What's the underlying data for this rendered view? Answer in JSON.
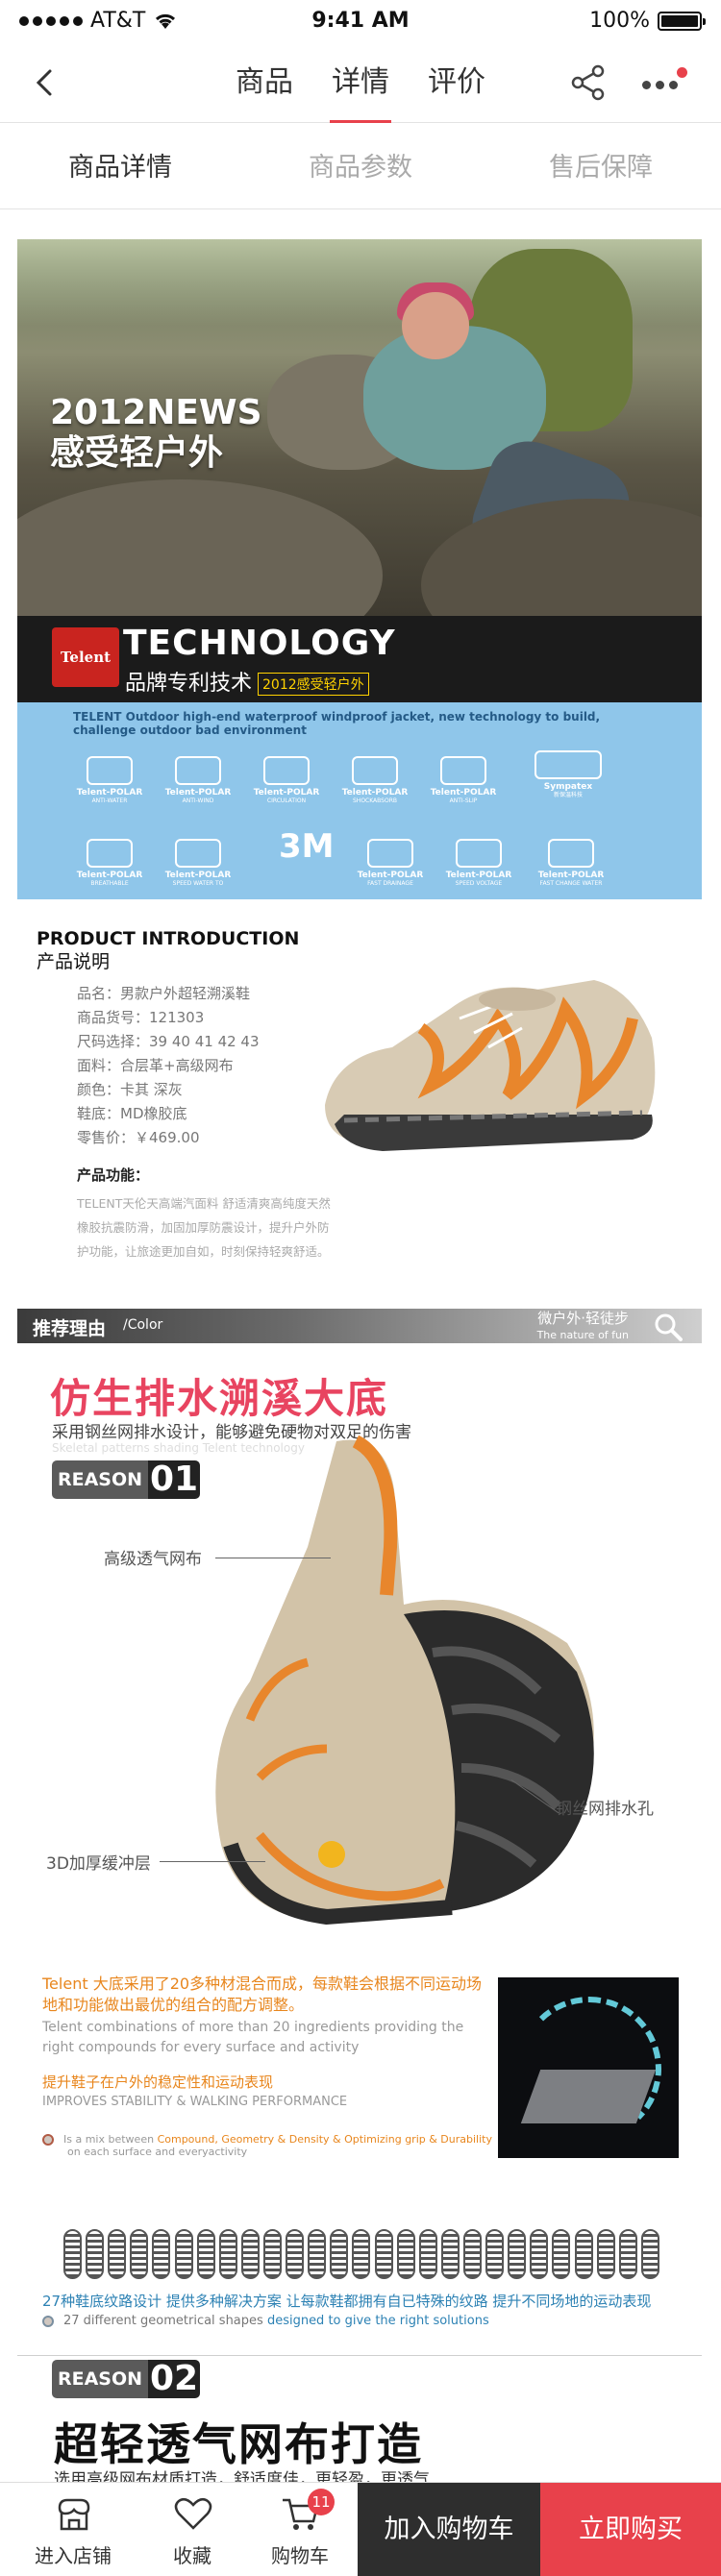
{
  "status_bar": {
    "carrier": "AT&T",
    "time": "9:41 AM",
    "battery": "100%",
    "battery_level": 1.0
  },
  "nav": {
    "tabs": [
      {
        "label": "商品",
        "active": false
      },
      {
        "label": "详情",
        "active": true
      },
      {
        "label": "评价",
        "active": false
      }
    ],
    "icons": [
      "back-arrow-icon",
      "share-icon",
      "more-icon"
    ],
    "accent_color": "#e8414b"
  },
  "sub_tabs": [
    {
      "label": "商品详情",
      "active": true
    },
    {
      "label": "商品参数",
      "active": false
    },
    {
      "label": "售后保障",
      "active": false
    }
  ],
  "hero": {
    "line1": "2012NEWS",
    "line2": "感受轻户外"
  },
  "technology": {
    "logo": "Telent",
    "title": "TECHNOLOGY",
    "subtitle": "品牌专利技术",
    "tag": "2012感受轻户外",
    "description": "TELENT Outdoor high-end waterproof windproof jacket, new technology to build, challenge outdoor bad environment",
    "icons_row1": [
      {
        "label": "Telent-POLAR",
        "sub": "ANTI-WATER"
      },
      {
        "label": "Telent-POLAR",
        "sub": "ANTI-WIND"
      },
      {
        "label": "Telent-POLAR",
        "sub": "CIRCULATION"
      },
      {
        "label": "Telent-POLAR",
        "sub": "SHOCKABSORB"
      },
      {
        "label": "Telent-POLAR",
        "sub": "ANTI-SLIP"
      },
      {
        "label": "Sympatex",
        "sub": "新保温科技"
      }
    ],
    "icons_row2": [
      {
        "label": "Telent-POLAR",
        "sub": "BREATHABLE"
      },
      {
        "label": "Telent-POLAR",
        "sub": "SPEED WATER TO"
      },
      {
        "label": "Telent-POLAR",
        "sub": "FAST DRAINAGE"
      },
      {
        "label": "Telent-POLAR",
        "sub": "SPEED VOLTAGE"
      },
      {
        "label": "Telent-POLAR",
        "sub": "FAST CHANGE WATER"
      }
    ],
    "badge_3m": "3M"
  },
  "introduction": {
    "title_en": "PRODUCT INTRODUCTION",
    "title_cn": "产品说明",
    "specs": [
      "品名：男款户外超轻溯溪鞋",
      "商品货号：121303",
      "尺码选择：39 40 41 42 43",
      "面料：合层革+高级网布",
      "颜色：卡其  深灰",
      "鞋底：MD橡胶底",
      "零售价：￥469.00"
    ],
    "function_title": "产品功能：",
    "function_desc": "TELENT天伦天高端汽面料 舒适清爽高纯度天然橡胶抗震防滑，加固加厚防震设计，提升户外防护功能，让旅途更加自如，时刻保持轻爽舒适。"
  },
  "recommend": {
    "title": "推荐理由",
    "title_en": "/Color",
    "right_cn": "微户外·轻徒步",
    "right_en": "The nature of fun",
    "search_icon": "search-icon"
  },
  "feature1": {
    "title": "仿生排水溯溪大底",
    "subtitle": "采用钢丝网排水设计，能够避免硬物对双足的伤害",
    "ghost": "Skeletal patterns shading Telent technology",
    "reason_label": "REASON >",
    "reason_num": "01",
    "callouts": [
      "高级透气网布",
      "钢丝网排水孔",
      "3D加厚缓冲层"
    ],
    "desc_cn": "Telent 大底采用了20多种材混合而成，每款鞋会根据不同运动场地和功能做出最优的组合的配方调整。",
    "desc_en": "Telent combinations of more than 20 ingredients providing the right compounds for every surface and activity",
    "stability_cn": "提升鞋子在户外的稳定性和运动表现",
    "stability_en": "IMPROVES STABILITY & WALKING PERFORMANCE",
    "mix_prefix": "Is a mix between",
    "mix_highlight": "Compound, Geometry & Density & Optimizing grip & Durability",
    "mix_suffix": "on each surface and everyactivity"
  },
  "treads": {
    "count": 27,
    "caption_cn": "27种鞋底纹路设计 提供多种解决方案 让每款鞋都拥有自已特殊的纹路 提升不同场地的运动表现",
    "caption_en_prefix": "27 different geometrical shapes",
    "caption_en_highlight": "designed to give the right solutions"
  },
  "feature2": {
    "reason_label": "REASON >",
    "reason_num": "02",
    "title": "超轻透气网布打造",
    "subtitle": "选用高级网布材质打造，舒适度佳，更轻盈，更透气"
  },
  "bottom_bar": {
    "store": "进入店铺",
    "favorite": "收藏",
    "cart": "购物车",
    "cart_count": "11",
    "add_to_cart": "加入购物车",
    "buy_now": "立即购买"
  }
}
